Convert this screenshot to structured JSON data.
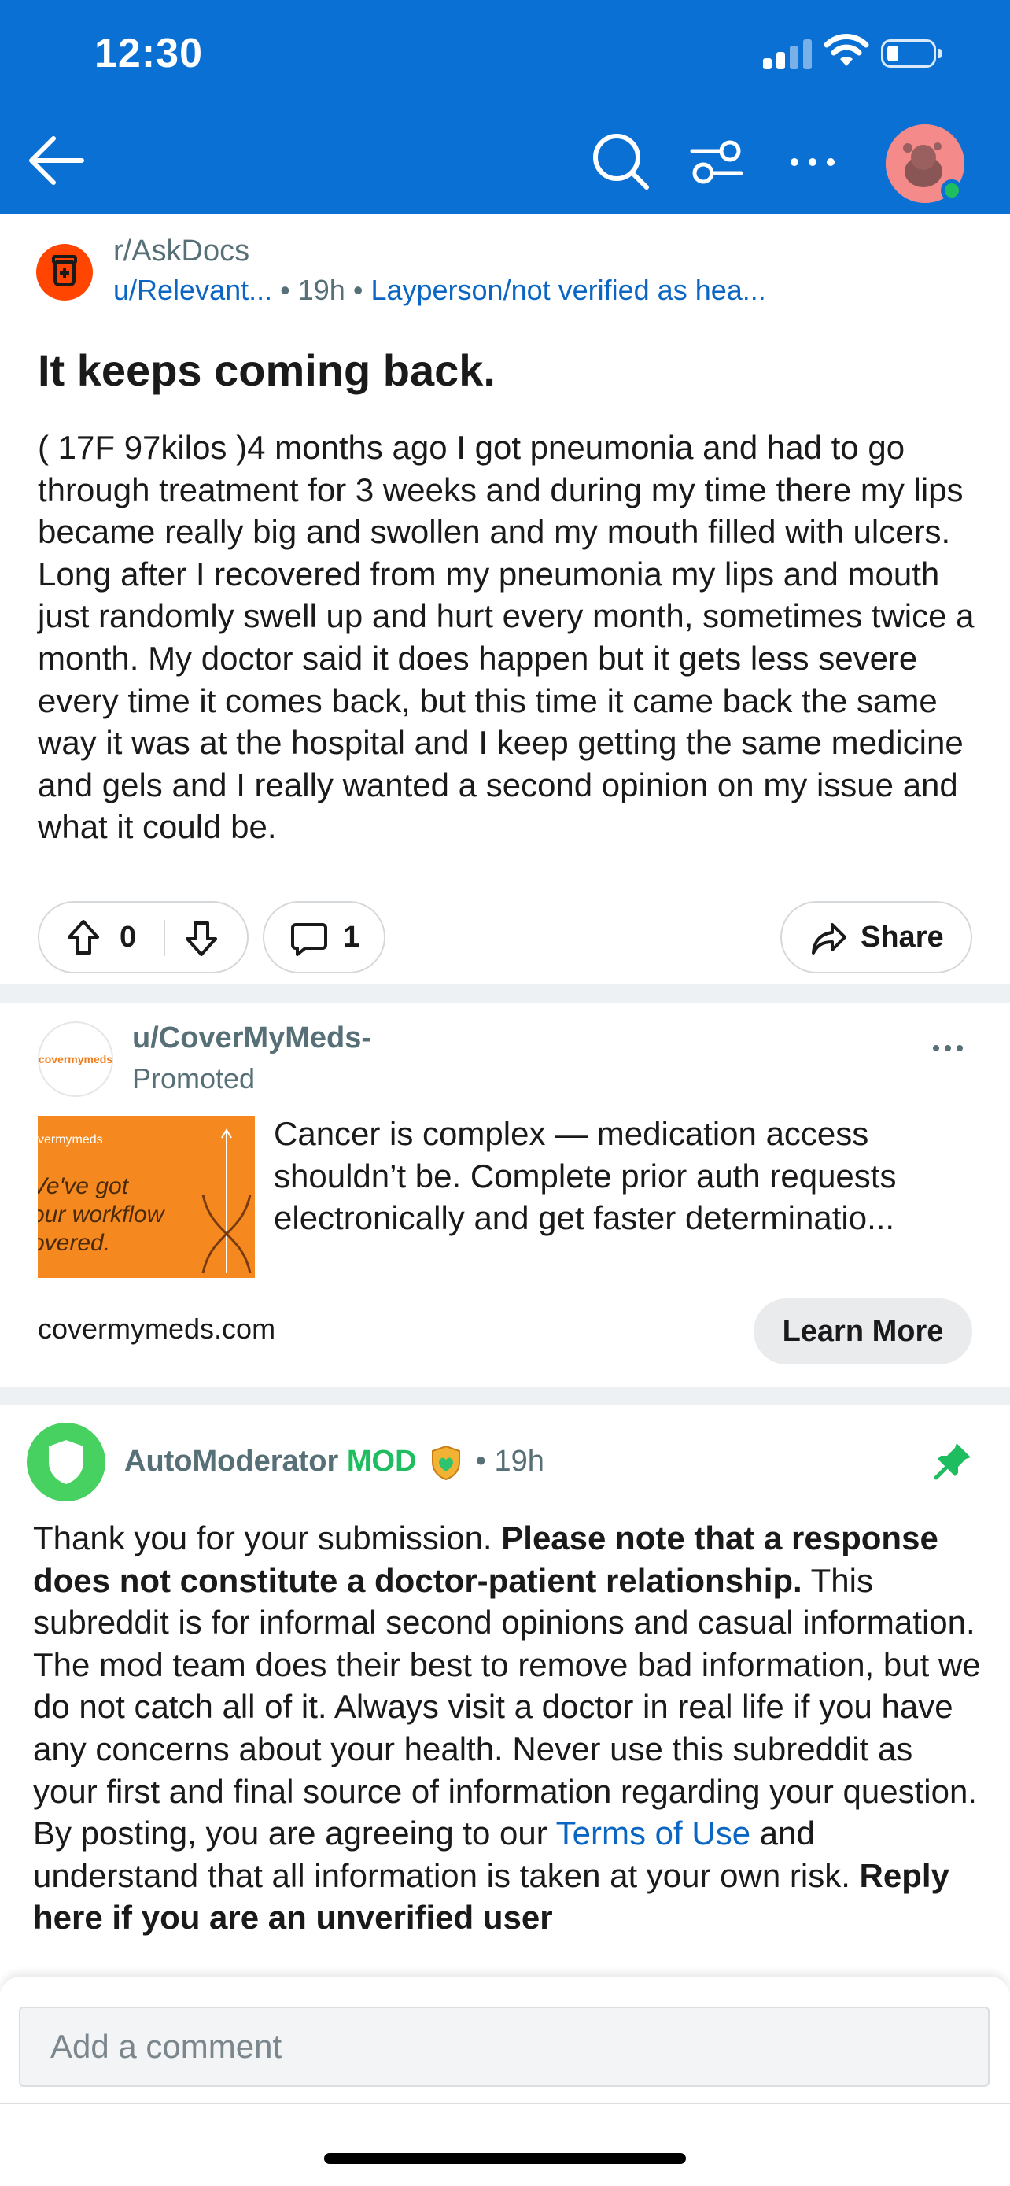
{
  "status_bar": {
    "time": "12:30"
  },
  "post": {
    "subreddit": "r/AskDocs",
    "author": "u/Relevant...",
    "age": "19h",
    "flair": "Layperson/not verified as hea...",
    "title": "It keeps coming back.",
    "body": "( 17F 97kilos )4 months ago I got pneumonia and had to go through treatment for 3 weeks and during my time there my lips became really big and swollen and my mouth filled with ulcers. Long after I recovered from my pneumonia my lips and mouth just randomly swell up and hurt every month, sometimes twice a month. My doctor said it does happen but it gets less severe every time it comes back, but this time it came back the same way it was at the hospital and I keep getting the same medicine and gels and I really wanted a second opinion on my issue and what it could be.",
    "votes": "0",
    "comments": "1",
    "share_label": "Share"
  },
  "ad": {
    "logo_text": "covermymeds",
    "user": "u/CoverMyMeds-",
    "promoted_label": "Promoted",
    "image_small_text": "vermymeds",
    "image_big_text": "Ve've got\nour workflow\novered.",
    "text": "Cancer is complex — medication access shouldn’t be. Complete prior auth requests electronically and get faster determinatio...",
    "domain": "covermymeds.com",
    "cta": "Learn More"
  },
  "comment": {
    "author": "AutoModerator",
    "mod_label": "MOD",
    "age": "19h",
    "body_1": "Thank you for your submission. ",
    "body_bold_1": "Please note that a response does not constitute a doctor-patient relationship.",
    "body_2": " This subreddit is for informal second opinions and casual information. The mod team does their best to remove bad information, but we do not catch all of it. Always visit a doctor in real life if you have any concerns about your health. Never use this subreddit as your first and final source of information regarding your question. By posting, you are agreeing to our ",
    "link": "Terms of Use",
    "body_3": " and understand that all information is taken at your own risk. ",
    "body_bold_2": "Reply here if you are an unverified user"
  },
  "comment_bar": {
    "placeholder": "Add a comment"
  },
  "colors": {
    "header_blue": "#0b70d3",
    "link_blue": "#0a66c2",
    "mod_green": "#1ebd5f",
    "subreddit_orange": "#ff4500"
  },
  "icons": [
    "back-arrow-icon",
    "search-icon",
    "filter-icon",
    "more-icon",
    "avatar",
    "upvote-icon",
    "downvote-icon",
    "comment-icon",
    "share-icon",
    "shield-icon",
    "pin-icon"
  ]
}
